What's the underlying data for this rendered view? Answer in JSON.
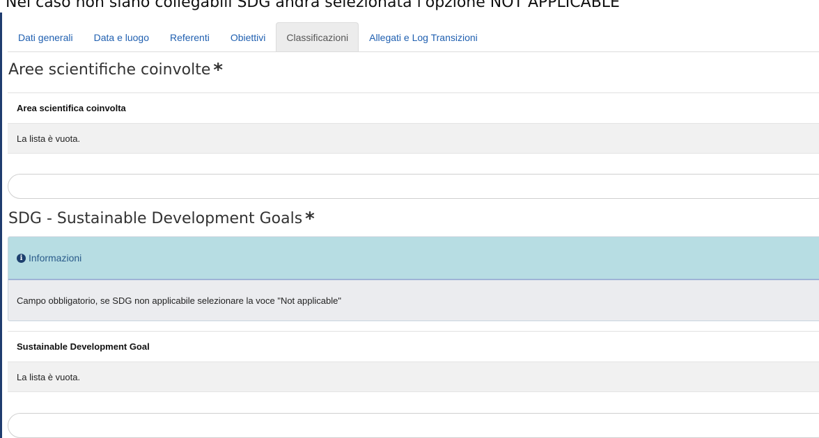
{
  "caption": "Nel caso non siano collegabili SDG andrà selezionata l'opzione NOT APPLICABLE",
  "tabs": [
    {
      "label": "Dati generali",
      "active": false
    },
    {
      "label": "Data e luogo",
      "active": false
    },
    {
      "label": "Referenti",
      "active": false
    },
    {
      "label": "Obiettivi",
      "active": false
    },
    {
      "label": "Classificazioni",
      "active": true
    },
    {
      "label": "Allegati e Log Transizioni",
      "active": false
    }
  ],
  "aree": {
    "title": "Aree scientifiche coinvolte",
    "required_mark": "*",
    "column_header": "Area scientifica coinvolta",
    "empty_text": "La lista è vuota.",
    "input_value": ""
  },
  "sdg": {
    "title": "SDG - Sustainable Development Goals",
    "required_mark": "*",
    "info_title": "Informazioni",
    "info_text": "Campo obbligatorio, se SDG non applicabile selezionare la voce \"Not applicable\"",
    "column_header": "Sustainable Development Goal",
    "empty_text": "La lista è vuota.",
    "input_value": ""
  },
  "colors": {
    "link": "#1f5fb0",
    "info_header_bg": "#b7dde3",
    "info_body_bg": "#ebecef",
    "frame_border": "#1f3c6e"
  },
  "icons": {
    "info": "info-circle-icon"
  }
}
